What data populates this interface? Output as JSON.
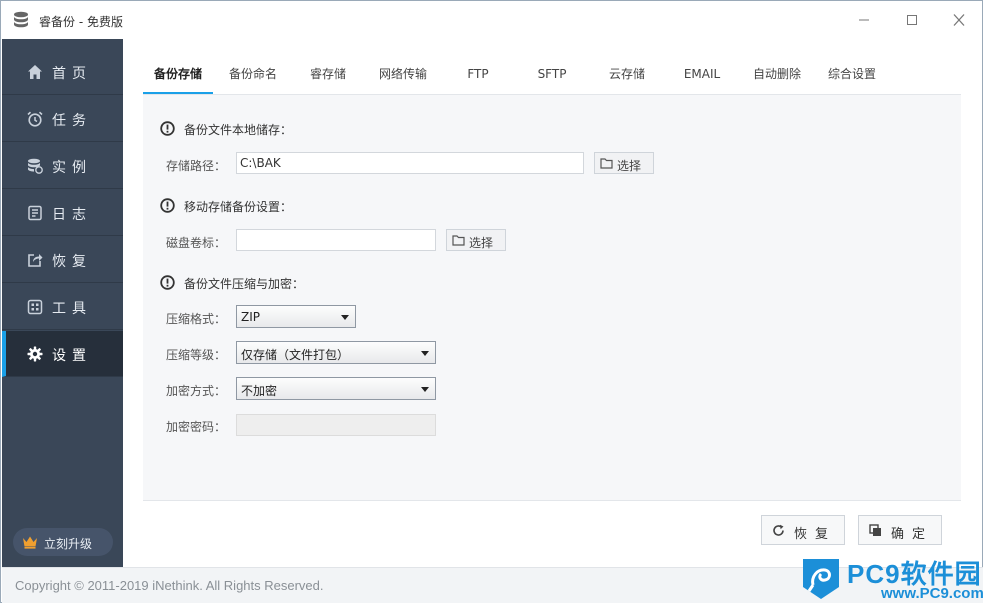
{
  "window": {
    "title": "睿备份 - 免费版",
    "min_symbol": "—",
    "max_symbol": "☐",
    "close_symbol": "✕"
  },
  "sidebar": {
    "items": [
      {
        "label": "首页",
        "icon": "home-icon"
      },
      {
        "label": "任务",
        "icon": "alarm-clock-icon"
      },
      {
        "label": "实例",
        "icon": "database-icon"
      },
      {
        "label": "日志",
        "icon": "log-document-icon"
      },
      {
        "label": "恢复",
        "icon": "export-icon"
      },
      {
        "label": "工具",
        "icon": "grid-tools-icon"
      },
      {
        "label": "设置",
        "icon": "gear-icon"
      }
    ],
    "active_index": 6,
    "upgrade_label": "立刻升级",
    "upgrade_icon": "crown-icon"
  },
  "tabs": [
    "备份存储",
    "备份命名",
    "睿存储",
    "网络传输",
    "FTP",
    "SFTP",
    "云存储",
    "EMAIL",
    "自动删除",
    "综合设置"
  ],
  "active_tab": 0,
  "local_storage": {
    "title": "备份文件本地储存：",
    "path_label": "存储路径：",
    "path_value": "C:\\BAK",
    "select_label": "选择"
  },
  "mobile_storage": {
    "title": "移动存储备份设置：",
    "volume_label": "磁盘卷标：",
    "volume_value": "",
    "select_label": "选择"
  },
  "compression": {
    "title": "备份文件压缩与加密：",
    "format_label": "压缩格式：",
    "format_value": "ZIP",
    "level_label": "压缩等级：",
    "level_value": "仅存储（文件打包）",
    "encrypt_label": "加密方式：",
    "encrypt_value": "不加密",
    "password_label": "加密密码：",
    "password_value": ""
  },
  "actions": {
    "restore_label": "恢复",
    "confirm_label": "确定"
  },
  "footer": {
    "copyright": "Copyright © 2011-2019 iNethink. All Rights Reserved."
  },
  "watermark": {
    "text": "PC9软件园",
    "url": "www.PC9.com"
  },
  "colors": {
    "sidebar_bg": "#3a4758",
    "sidebar_active_bg": "#262f3b",
    "accent": "#1aa0e8",
    "panel_bg": "#f6f7f9",
    "watermark": "#1c8fd8"
  }
}
